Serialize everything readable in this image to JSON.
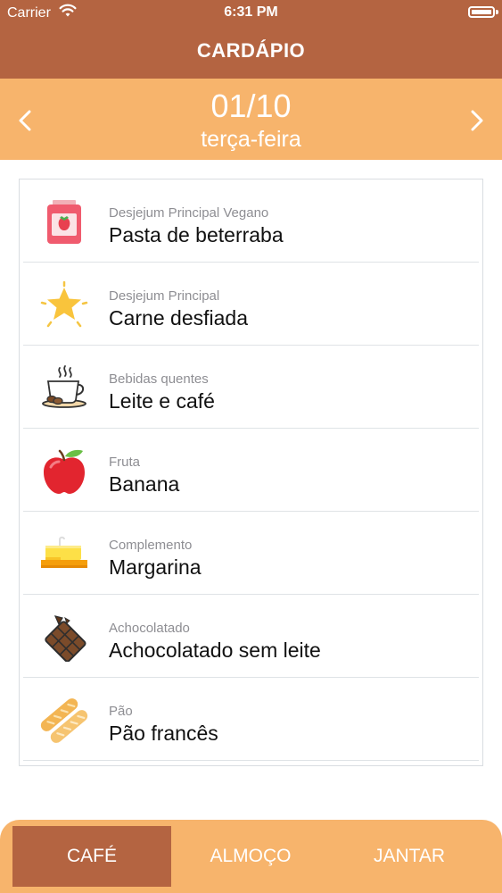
{
  "status_bar": {
    "carrier": "Carrier",
    "time": "6:31 PM"
  },
  "header": {
    "title": "CARDÁPIO"
  },
  "date_nav": {
    "date": "01/10",
    "weekday": "terça-feira",
    "prev_icon": "chevron-left-icon",
    "next_icon": "chevron-right-icon"
  },
  "menu_items": [
    {
      "category": "Desjejum Principal Vegano",
      "item": "Pasta de beterraba",
      "icon": "jam-jar-icon"
    },
    {
      "category": "Desjejum Principal",
      "item": "Carne desfiada",
      "icon": "star-icon"
    },
    {
      "category": "Bebidas quentes",
      "item": "Leite e café",
      "icon": "coffee-cup-icon"
    },
    {
      "category": "Fruta",
      "item": "Banana",
      "icon": "apple-icon"
    },
    {
      "category": "Complemento",
      "item": "Margarina",
      "icon": "butter-icon"
    },
    {
      "category": "Achocolatado",
      "item": "Achocolatado sem leite",
      "icon": "chocolate-bar-icon"
    },
    {
      "category": "Pão",
      "item": "Pão francês",
      "icon": "bread-icon"
    }
  ],
  "tabs": [
    {
      "label": "CAFÉ",
      "active": true
    },
    {
      "label": "ALMOÇO",
      "active": false
    },
    {
      "label": "JANTAR",
      "active": false
    }
  ],
  "colors": {
    "header": "#b46441",
    "accent": "#f7b46c",
    "text": "#111111",
    "muted": "#8e8e93"
  }
}
